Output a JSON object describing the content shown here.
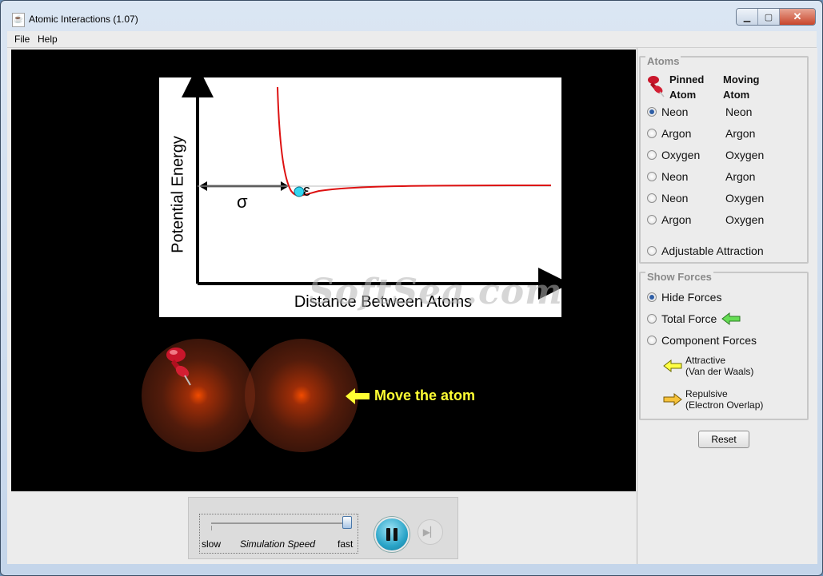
{
  "window": {
    "title": "Atomic Interactions (1.07)"
  },
  "menu": {
    "file": "File",
    "help": "Help"
  },
  "graph": {
    "y_label": "Potential Energy",
    "x_label": "Distance Between Atoms",
    "sigma": "σ",
    "epsilon": "ε"
  },
  "watermark": "SoftSea.com",
  "move_label": "Move the atom",
  "controls": {
    "slow": "slow",
    "speed_label": "Simulation Speed",
    "fast": "fast",
    "speed_value": 1.0
  },
  "atoms_panel": {
    "title": "Atoms",
    "pinned_header_1": "Pinned",
    "pinned_header_2": "Atom",
    "moving_header_1": "Moving",
    "moving_header_2": "Atom",
    "rows": [
      {
        "pinned": "Neon",
        "moving": "Neon",
        "selected": true
      },
      {
        "pinned": "Argon",
        "moving": "Argon",
        "selected": false
      },
      {
        "pinned": "Oxygen",
        "moving": "Oxygen",
        "selected": false
      },
      {
        "pinned": "Neon",
        "moving": "Argon",
        "selected": false
      },
      {
        "pinned": "Neon",
        "moving": "Oxygen",
        "selected": false
      },
      {
        "pinned": "Argon",
        "moving": "Oxygen",
        "selected": false
      }
    ],
    "adjustable": "Adjustable Attraction"
  },
  "forces_panel": {
    "title": "Show Forces",
    "hide": "Hide Forces",
    "total": "Total Force",
    "component": "Component Forces",
    "attractive_1": "Attractive",
    "attractive_2": "(Van der Waals)",
    "repulsive_1": "Repulsive",
    "repulsive_2": "(Electron Overlap)",
    "selected": "Hide Forces"
  },
  "reset": "Reset",
  "colors": {
    "curve": "#dd1111",
    "marker": "#33d6f0",
    "move_label": "#ffff33",
    "total_arrow": "#66dd55",
    "attractive_arrow": "#ffff44",
    "repulsive_arrow": "#f6c23a"
  }
}
